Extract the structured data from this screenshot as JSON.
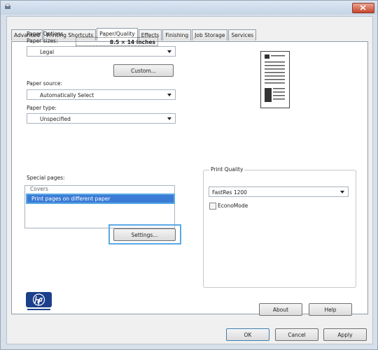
{
  "window": {
    "close_glyph": "×"
  },
  "tabs": [
    {
      "label": "Advanced"
    },
    {
      "label": "Printing Shortcuts"
    },
    {
      "label": "Paper/Quality"
    },
    {
      "label": "Effects"
    },
    {
      "label": "Finishing"
    },
    {
      "label": "Job Storage"
    },
    {
      "label": "Services"
    }
  ],
  "paper_options": {
    "heading": "Paper Options",
    "sizes_label": "Paper sizes:",
    "size_value": "8.5 × 14 inches",
    "size_combo": "Legal",
    "custom_button": "Custom...",
    "source_label": "Paper source:",
    "source_value": "Automatically Select",
    "type_label": "Paper type:",
    "type_value": "Unspecified"
  },
  "special_pages": {
    "label": "Special pages:",
    "items": [
      {
        "text": "Covers"
      },
      {
        "text": "Print pages on different paper"
      }
    ],
    "selected_index": 1,
    "settings_button": "Settings..."
  },
  "print_quality": {
    "title": "Print Quality",
    "value": "FastRes 1200",
    "economode_label": "EconoMode",
    "economode_checked": false
  },
  "bottom_buttons": {
    "about": "About",
    "help": "Help",
    "ok": "OK",
    "cancel": "Cancel",
    "apply": "Apply"
  },
  "icons": [
    "app-icon",
    "close-icon",
    "hp-logo",
    "page-preview-icon",
    "dropdown-arrow-icon"
  ],
  "colors": {
    "selection": "#3a7bd5",
    "close_button": "#c8452d",
    "frame": "#d7e0ea"
  }
}
